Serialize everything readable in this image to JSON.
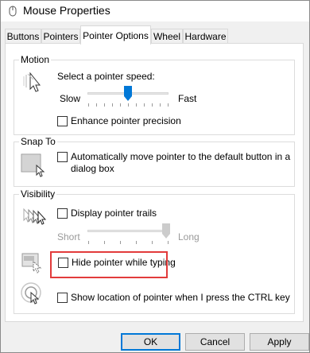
{
  "window": {
    "title": "Mouse Properties"
  },
  "tabs": [
    {
      "label": "Buttons"
    },
    {
      "label": "Pointers"
    },
    {
      "label": "Pointer Options"
    },
    {
      "label": "Wheel"
    },
    {
      "label": "Hardware"
    }
  ],
  "motion": {
    "title": "Motion",
    "speed_label": "Select a pointer speed:",
    "slow_label": "Slow",
    "fast_label": "Fast",
    "speed_value_fraction": 0.5,
    "enhance_label": "Enhance pointer precision",
    "enhance_checked": false
  },
  "snap_to": {
    "title": "Snap To",
    "auto_move_label_line1": "Automatically move pointer to the default button in a",
    "auto_move_label_line2": "dialog box",
    "auto_move_checked": false
  },
  "visibility": {
    "title": "Visibility",
    "trails_label": "Display pointer trails",
    "trails_checked": false,
    "short_label": "Short",
    "long_label": "Long",
    "trail_length_fraction": 1.0,
    "hide_label": "Hide pointer while typing",
    "hide_checked": false,
    "ctrl_label": "Show location of pointer when I press the CTRL key",
    "ctrl_checked": false
  },
  "buttons": {
    "ok": "OK",
    "cancel": "Cancel",
    "apply": "Apply"
  },
  "colors": {
    "highlight": "#e23b3b",
    "accent": "#0078d7"
  }
}
